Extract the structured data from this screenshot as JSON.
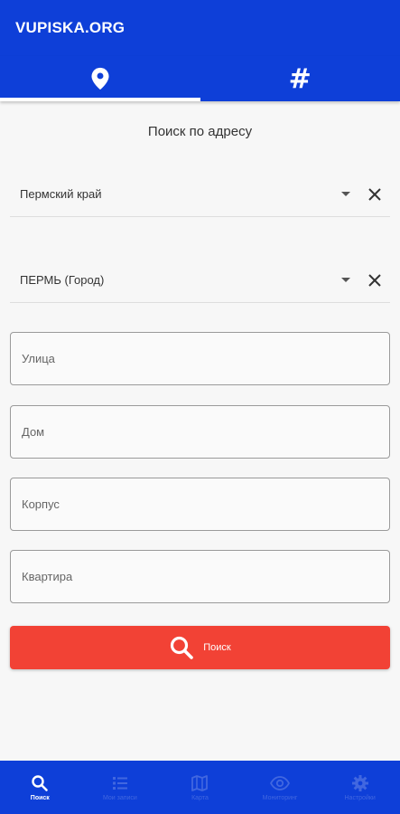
{
  "app": {
    "title": "VUPISKA.ORG"
  },
  "tabs": [
    {
      "icon": "location-pin-icon",
      "active": true
    },
    {
      "icon": "hash-icon",
      "glyph": "#",
      "active": false
    }
  ],
  "form": {
    "title": "Поиск по адресу",
    "region": {
      "value": "Пермский край"
    },
    "city": {
      "value": "ПЕРМЬ (Город)"
    },
    "street": {
      "placeholder": "Улица",
      "value": ""
    },
    "house": {
      "placeholder": "Дом",
      "value": ""
    },
    "building": {
      "placeholder": "Корпус",
      "value": ""
    },
    "apartment": {
      "placeholder": "Квартира",
      "value": ""
    },
    "search_label": "Поиск"
  },
  "bottom_nav": [
    {
      "label": "Поиск",
      "icon": "search-icon",
      "active": true
    },
    {
      "label": "Мои записи",
      "icon": "list-icon",
      "active": false
    },
    {
      "label": "Карта",
      "icon": "map-icon",
      "active": false
    },
    {
      "label": "Мониторинг",
      "icon": "eye-icon",
      "active": false
    },
    {
      "label": "Настройки",
      "icon": "gear-icon",
      "active": false
    }
  ],
  "colors": {
    "primary": "#0e3fd8",
    "accent": "#f24235",
    "inactive": "#4167e0"
  }
}
